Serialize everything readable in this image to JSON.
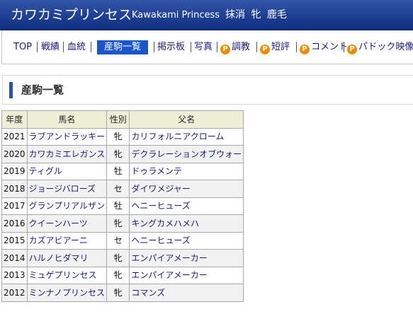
{
  "header": {
    "title_ja": "カワカミプリンセス",
    "title_en": "Kawakami Princess",
    "sex_info": "抹消 牝 鹿毛"
  },
  "nav": {
    "items": [
      {
        "label": "TOP"
      },
      {
        "label": "戦績"
      },
      {
        "label": "血統"
      },
      {
        "label": "産駒一覧"
      },
      {
        "label": "掲示板"
      },
      {
        "label": "写真"
      },
      {
        "label": "調教",
        "badge": "P"
      },
      {
        "label": "短評",
        "badge": "P"
      },
      {
        "label": "コメント",
        "badge": "P"
      },
      {
        "label": "パドック映像",
        "badge": "P"
      }
    ]
  },
  "section": {
    "title": "産駒一覧"
  },
  "table": {
    "headers": [
      "年度",
      "馬名",
      "性別",
      "父名"
    ],
    "rows": [
      {
        "year": "2021",
        "name": "ラブアンドラッキー",
        "sex": "牝",
        "sire": "カリフォルニアクローム"
      },
      {
        "year": "2020",
        "name": "カワカミエレガンス",
        "sex": "牝",
        "sire": "デクラレーションオブウォー"
      },
      {
        "year": "2019",
        "name": "ティグル",
        "sex": "牡",
        "sire": "ドゥラメンテ"
      },
      {
        "year": "2018",
        "name": "ジョージバローズ",
        "sex": "セ",
        "sire": "ダイワメジャー"
      },
      {
        "year": "2017",
        "name": "グランプリアルザン",
        "sex": "牡",
        "sire": "ヘニーヒューズ"
      },
      {
        "year": "2016",
        "name": "クイーンハーツ",
        "sex": "牝",
        "sire": "キングカメハメハ"
      },
      {
        "year": "2015",
        "name": "カズアビアーニ",
        "sex": "セ",
        "sire": "ヘニーヒューズ"
      },
      {
        "year": "2014",
        "name": "ハルノヒダマリ",
        "sex": "牝",
        "sire": "エンパイアメーカー"
      },
      {
        "year": "2013",
        "name": "ミュゲプリンセス",
        "sex": "牝",
        "sire": "エンパイアメーカー"
      },
      {
        "year": "2012",
        "name": "ミンナノプリンセス",
        "sex": "牝",
        "sire": "コマンズ"
      }
    ]
  },
  "colors": {
    "header_bg": "#1f3f96",
    "nav_active_bg": "#1a55cc",
    "badge": "#f08b00",
    "link": "#1a1a7a",
    "table_header_bg": "#efefd8",
    "section_bar": "#2d4fa8"
  },
  "icons": {
    "badge": "p-badge-icon"
  }
}
